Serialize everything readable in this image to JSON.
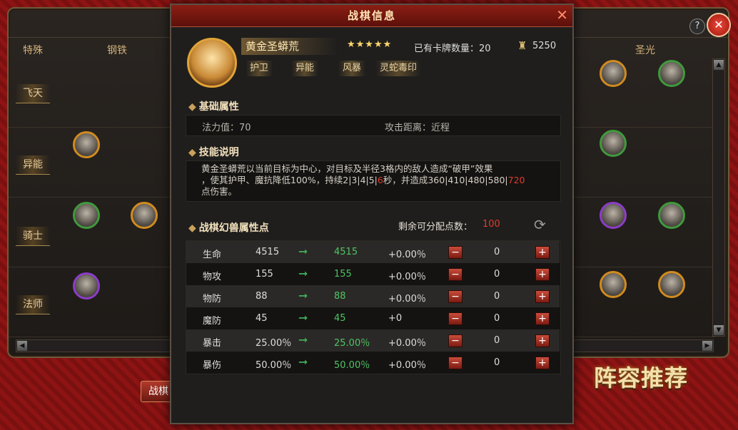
{
  "background": {
    "column_headers": [
      "特殊",
      "钢铁",
      "圣光"
    ],
    "row_labels": [
      "飞天",
      "异能",
      "骑士",
      "法师"
    ],
    "bottom_button": "战棋",
    "recommend_label": "阵容推荐",
    "help_icon": "?",
    "close_icon": "✕"
  },
  "dialog": {
    "title": "战棋信息",
    "close": "✕",
    "hero": {
      "name": "黄金圣蟒荒",
      "stars": "★★★★★",
      "owned_label": "已有卡牌数量：20",
      "gold_value": "5250",
      "tags": [
        "护卫",
        "异能",
        "风暴",
        "灵蛇毒印"
      ]
    },
    "basic": {
      "title": "基础属性",
      "mana": "法力值：70",
      "range": "攻击距离：近程"
    },
    "skill": {
      "title": "技能说明",
      "line1": "黄金圣蟒荒以当前目标为中心，对目标及半径3格内的敌人造成“破甲”效果",
      "line2a": "，使其护甲、魔抗降低100%，持续2|3|4|5|",
      "line2b": "6",
      "line2c": "秒，并造成360|410|480|580|",
      "line2d": "720",
      "line3": "点伤害。"
    },
    "stats": {
      "title": "战棋幻兽属性点",
      "remain_label": "剩余可分配点数：",
      "remain_value": "100",
      "rows": [
        {
          "name": "生命",
          "base": "4515",
          "new": "4515",
          "pct": "+0.00％",
          "pts": "0"
        },
        {
          "name": "物攻",
          "base": "155",
          "new": "155",
          "pct": "+0.00％",
          "pts": "0"
        },
        {
          "name": "物防",
          "base": "88",
          "new": "88",
          "pct": "+0.00％",
          "pts": "0"
        },
        {
          "name": "魔防",
          "base": "45",
          "new": "45",
          "pct": "+0",
          "pts": "0"
        },
        {
          "name": "暴击",
          "base": "25.00％",
          "new": "25.00％",
          "pct": "+0.00％",
          "pts": "0"
        },
        {
          "name": "暴伤",
          "base": "50.00％",
          "new": "50.00％",
          "pct": "+0.00％",
          "pts": "0"
        }
      ],
      "arrow": "➞",
      "minus": "−",
      "plus": "+"
    }
  },
  "colors": {
    "accent_red": "#e23b2a",
    "value_green": "#4ec463",
    "gold": "#d18b1f"
  }
}
